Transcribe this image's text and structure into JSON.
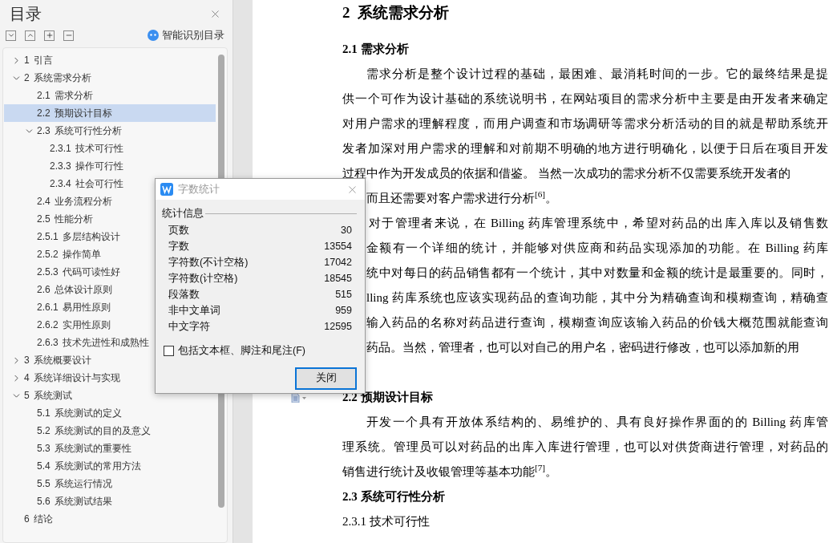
{
  "sidebar": {
    "title": "目录",
    "smart_button": "智能识别目录",
    "toc": [
      {
        "number": "1",
        "title": "引言",
        "expanded": false,
        "selected": false
      },
      {
        "number": "2",
        "title": "系统需求分析",
        "expanded": true,
        "selected": false,
        "children": [
          {
            "number": "2.1",
            "title": "需求分析",
            "selected": false
          },
          {
            "number": "2.2",
            "title": "预期设计目标",
            "selected": true
          },
          {
            "number": "2.3",
            "title": "系统可行性分析",
            "expanded": true,
            "selected": false,
            "children": [
              {
                "number": "2.3.1",
                "title": "技术可行性",
                "selected": false
              },
              {
                "number": "2.3.3",
                "title": "操作可行性",
                "selected": false
              },
              {
                "number": "2.3.4",
                "title": "社会可行性",
                "selected": false
              }
            ]
          },
          {
            "number": "2.4",
            "title": "业务流程分析",
            "selected": false
          },
          {
            "number": "2.5",
            "title": "性能分析",
            "selected": false
          },
          {
            "number": "2.5.1",
            "title": "多层结构设计",
            "selected": false
          },
          {
            "number": "2.5.2",
            "title": "操作简单",
            "selected": false
          },
          {
            "number": "2.5.3",
            "title": "代码可读性好",
            "selected": false
          },
          {
            "number": "2.6",
            "title": "总体设计原则",
            "selected": false
          },
          {
            "number": "2.6.1",
            "title": "易用性原则",
            "selected": false
          },
          {
            "number": "2.6.2",
            "title": "实用性原则",
            "selected": false
          },
          {
            "number": "2.6.3",
            "title": "技术先进性和成熟性",
            "selected": false
          }
        ]
      },
      {
        "number": "3",
        "title": "系统概要设计",
        "expanded": false,
        "selected": false
      },
      {
        "number": "4",
        "title": "系统详细设计与实现",
        "expanded": false,
        "selected": false
      },
      {
        "number": "5",
        "title": "系统测试",
        "expanded": true,
        "selected": false,
        "children": [
          {
            "number": "5.1",
            "title": "系统测试的定义",
            "selected": false
          },
          {
            "number": "5.2",
            "title": "系统测试的目的及意义",
            "selected": false
          },
          {
            "number": "5.3",
            "title": "系统测试的重要性",
            "selected": false
          },
          {
            "number": "5.4",
            "title": "系统测试的常用方法",
            "selected": false
          },
          {
            "number": "5.5",
            "title": "系统运行情况",
            "selected": false
          },
          {
            "number": "5.6",
            "title": "系统测试结果",
            "selected": false
          }
        ]
      },
      {
        "number": "6",
        "title": "结论",
        "selected": false
      }
    ]
  },
  "document": [
    {
      "kind": "h1",
      "text": "2  系统需求分析"
    },
    {
      "kind": "h2",
      "text": "2.1 需求分析"
    },
    {
      "kind": "paragraph",
      "lines": [
        "需求分析是整个设计过程的基础，最困难、最消耗时间的一步。它的最终结果是提",
        "供一个可作为设计基础的系统说明书，在网站项目的需求分析中主要是由开发者来确定",
        "对用户需求的理解程度，而用户调查和市场调研等需求分析活动的目的就是帮助系统开",
        "发者加深对用户需求的理解和对前期不明确的地方进行明确化，以便于日后在项目开发",
        "过程中作为开发成员的依据和借鉴。 当然一次成功的需求分析不仅需要系统开发者的"
      ]
    },
    {
      "kind": "clipped",
      "fragments": [
        [
          "而且还需要对客户需求进行分析$^{[6]}$。"
        ],
        [
          "对于管理者来说，在 Billing 药库管理系统中，希望对药品的出库入库以及销售数",
          "金额有一个详细的统计，并能够对供应商和药品实现添加的功能。在 Billing 药库",
          "统中对每日的药品销售都有一个统计，其中对数量和金额的统计是最重要的。同时，",
          "lling 药库系统也应该实现药品的查询功能，其中分为精确查询和模糊查询，精确查",
          "输入药品的名称对药品进行查询，模糊查询应该输入药品的价钱大概范围就能查询",
          "药品。当然，管理者，也可以对自己的用户名，密码进行修改，也可以添加新的用"
        ]
      ]
    },
    {
      "kind": "h2",
      "text": "2.2 预期设计目标"
    },
    {
      "kind": "paragraph",
      "lines": [
        "开发一个具有开放体系结构的、易维护的、具有良好操作界面的的 Billing 药库管",
        "理系统。管理员可以对药品的出库入库进行管理，也可以对供货商进行管理，对药品的",
        "销售进行统计及收银管理等基本功能$^{[7]}$。"
      ]
    },
    {
      "kind": "h2",
      "text": "2.3 系统可行性分析"
    },
    {
      "kind": "h3",
      "text": "2.3.1 技术可行性"
    }
  ],
  "dialog": {
    "title": "字数统计",
    "group": "统计信息",
    "stats": [
      {
        "label": "页数",
        "value": "30"
      },
      {
        "label": "字数",
        "value": "13554"
      },
      {
        "label": "字符数(不计空格)",
        "value": "17042"
      },
      {
        "label": "字符数(计空格)",
        "value": "18545"
      },
      {
        "label": "段落数",
        "value": "515"
      },
      {
        "label": "非中文单词",
        "value": "959"
      },
      {
        "label": "中文字符",
        "value": "12595"
      }
    ],
    "checkbox": {
      "label": "包括文本框、脚注和尾注(F)",
      "checked": false
    },
    "close_button": "关闭"
  }
}
